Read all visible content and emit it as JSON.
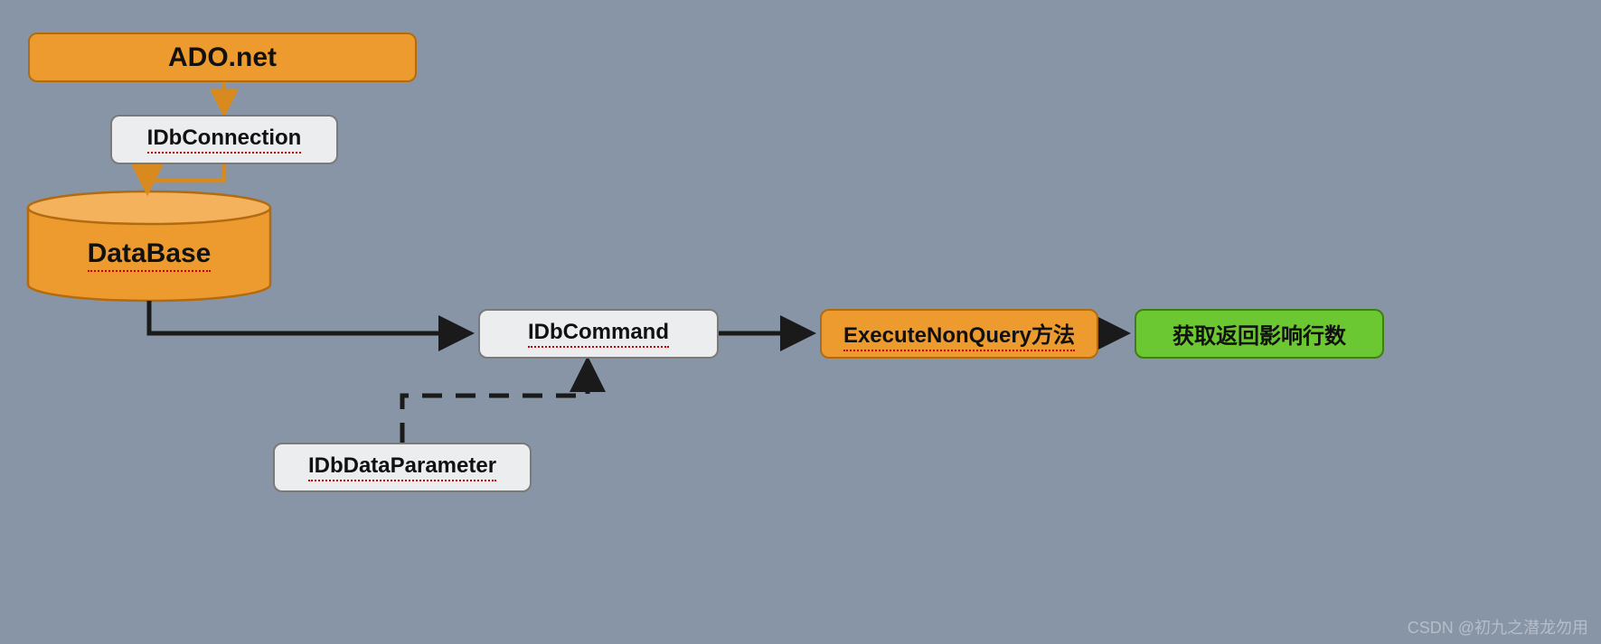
{
  "nodes": {
    "ado_net": "ADO.net",
    "idb_connection": "IDbConnection",
    "database": "DataBase",
    "idb_command": "IDbCommand",
    "idb_data_parameter": "IDbDataParameter",
    "execute_nonquery": "ExecuteNonQuery方法",
    "result": "获取返回影响行数"
  },
  "colors": {
    "orange_fill": "#ed9b2e",
    "orange_stroke": "#b36b0f",
    "gray_fill": "#ecedef",
    "gray_stroke": "#7a7a7a",
    "green_fill": "#6bc832",
    "green_stroke": "#3f7f14",
    "bg": "#8795a7",
    "arrow_black": "#1a1a1a",
    "arrow_orange": "#d98a1f"
  },
  "watermark": "CSDN @初九之潜龙勿用"
}
